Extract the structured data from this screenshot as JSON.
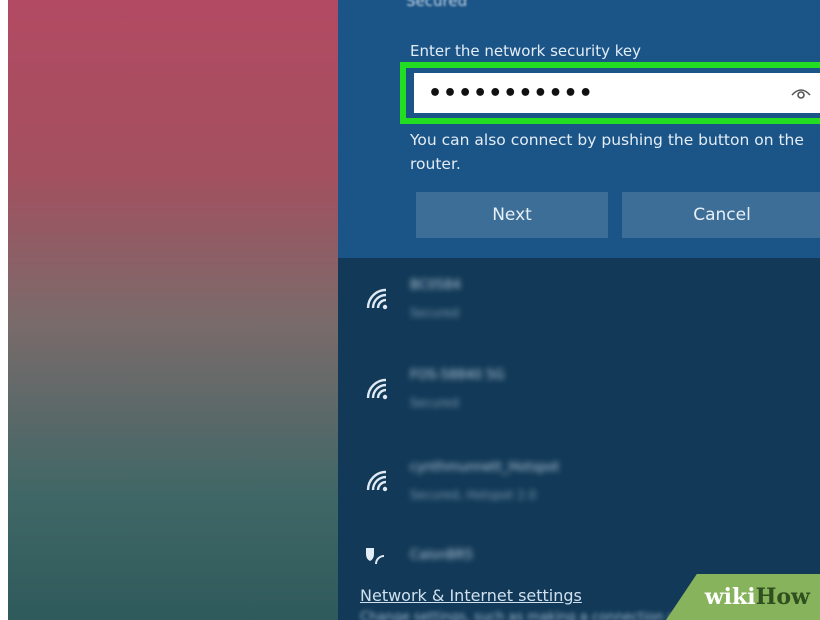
{
  "panel": {
    "secured_label": "Secured",
    "security_key_label": "Enter the network security key",
    "security_key_value": "•••••••••••",
    "hint": "You can also connect by pushing the button on the router.",
    "buttons": {
      "next": "Next",
      "cancel": "Cancel"
    }
  },
  "networks": [
    {
      "name": "BC0584",
      "status": "Secured"
    },
    {
      "name": "FOS-58840 5G",
      "status": "Secured"
    },
    {
      "name": "cynthmunnett_Hotspot",
      "status": "Secured, Hotspot 2.0"
    },
    {
      "name": "CalonBR5",
      "status": ""
    }
  ],
  "footer": {
    "settings_link": "Network & Internet settings",
    "settings_sub": "Change settings, such as making a connection metered."
  },
  "watermark": {
    "part1": "wiki",
    "part2": "How"
  },
  "colors": {
    "panel_top": "#1b5486",
    "panel_body": "#123a58",
    "highlight": "#22dd22",
    "button": "#3d6e98"
  },
  "icons": [
    "wifi-icon",
    "eye-icon",
    "shield-icon"
  ]
}
